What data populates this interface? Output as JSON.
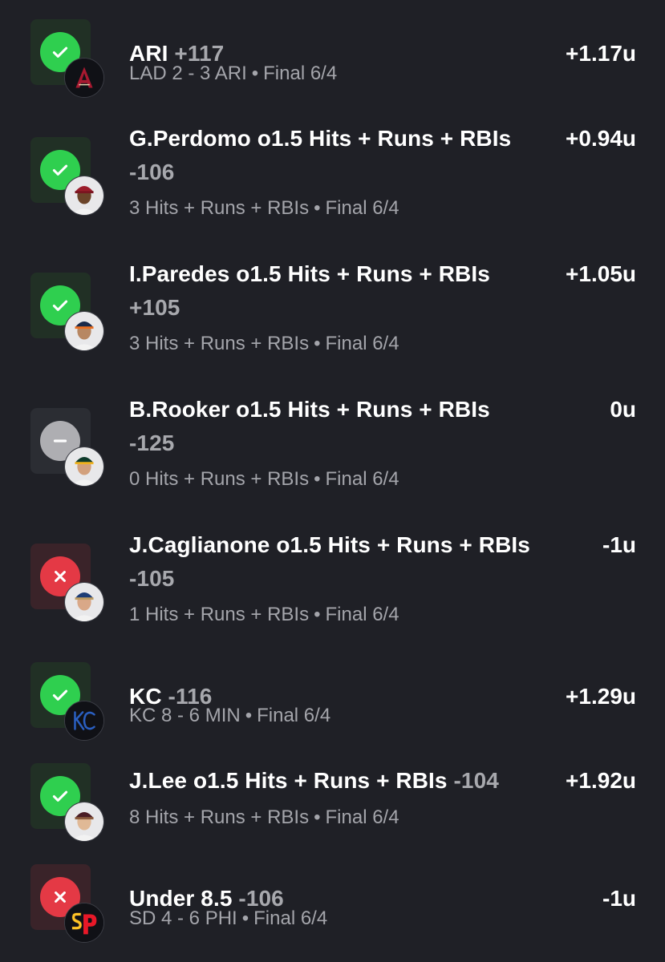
{
  "bets": [
    {
      "status": "win",
      "avatar_icon": "diamondbacks-logo-icon",
      "title": "ARI",
      "odds": "+117",
      "result": "+1.17u",
      "detail": "LAD 2 - 3 ARI",
      "state": "Final 6/4"
    },
    {
      "status": "win",
      "avatar_icon": "player-headshot-icon",
      "title": "G.Perdomo o1.5 Hits + Runs + RBIs",
      "odds": "-106",
      "result": "+0.94u",
      "detail": "3 Hits + Runs + RBIs",
      "state": "Final 6/4"
    },
    {
      "status": "win",
      "avatar_icon": "player-headshot-icon",
      "title": "I.Paredes o1.5 Hits + Runs + RBIs",
      "odds": "+105",
      "result": "+1.05u",
      "detail": "3 Hits + Runs + RBIs",
      "state": "Final 6/4"
    },
    {
      "status": "push",
      "avatar_icon": "player-headshot-icon",
      "title": "B.Rooker o1.5 Hits + Runs + RBIs",
      "odds": "-125",
      "result": "0u",
      "detail": "0 Hits + Runs + RBIs",
      "state": "Final 6/4"
    },
    {
      "status": "loss",
      "avatar_icon": "player-headshot-icon",
      "title": "J.Caglianone o1.5 Hits + Runs + RBIs",
      "odds": "-105",
      "result": "-1u",
      "detail": "1 Hits + Runs + RBIs",
      "state": "Final 6/4"
    },
    {
      "status": "win",
      "avatar_icon": "royals-logo-icon",
      "title": "KC",
      "odds": "-116",
      "result": "+1.29u",
      "detail": "KC 8 - 6 MIN",
      "state": "Final 6/4"
    },
    {
      "status": "win",
      "avatar_icon": "player-headshot-icon",
      "title": "J.Lee o1.5 Hits + Runs + RBIs",
      "odds": "-104",
      "result": "+1.92u",
      "detail": "8 Hits + Runs + RBIs",
      "state": "Final 6/4"
    },
    {
      "status": "loss",
      "avatar_icon": "padres-phillies-logo-icon",
      "title": "Under 8.5",
      "odds": "-106",
      "result": "-1u",
      "detail": "SD 4 - 6 PHI",
      "state": "Final 6/4"
    }
  ],
  "separator": "•",
  "colors": {
    "background": "#1f2026",
    "win": "#2fcf4f",
    "loss": "#e43945",
    "push": "#aeaeb2",
    "muted_text": "#a4a5ab"
  }
}
